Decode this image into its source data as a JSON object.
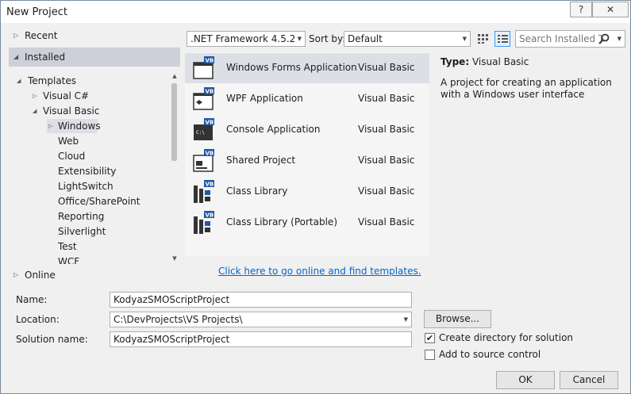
{
  "window": {
    "title": "New Project",
    "help_label": "?",
    "close_label": "✕"
  },
  "nav": {
    "recent": "Recent",
    "installed": "Installed",
    "online": "Online"
  },
  "tree": {
    "items": [
      {
        "label": "Templates"
      },
      {
        "label": "Visual C#"
      },
      {
        "label": "Visual Basic"
      },
      {
        "label": "Windows"
      },
      {
        "label": "Web"
      },
      {
        "label": "Cloud"
      },
      {
        "label": "Extensibility"
      },
      {
        "label": "LightSwitch"
      },
      {
        "label": "Office/SharePoint"
      },
      {
        "label": "Reporting"
      },
      {
        "label": "Silverlight"
      },
      {
        "label": "Test"
      },
      {
        "label": "WCF"
      }
    ]
  },
  "toolbar": {
    "framework": ".NET Framework 4.5.2",
    "sort_label": "Sort by:",
    "sort_value": "Default",
    "search_placeholder": "Search Installed Te"
  },
  "templates": [
    {
      "name": "Windows Forms Application",
      "lang": "Visual Basic",
      "icon": "winforms-icon"
    },
    {
      "name": "WPF Application",
      "lang": "Visual Basic",
      "icon": "wpf-icon"
    },
    {
      "name": "Console Application",
      "lang": "Visual Basic",
      "icon": "console-icon"
    },
    {
      "name": "Shared Project",
      "lang": "Visual Basic",
      "icon": "shared-project-icon"
    },
    {
      "name": "Class Library",
      "lang": "Visual Basic",
      "icon": "class-library-icon"
    },
    {
      "name": "Class Library (Portable)",
      "lang": "Visual Basic",
      "icon": "portable-library-icon"
    }
  ],
  "description": {
    "type_label": "Type:",
    "type_value": "Visual Basic",
    "text": "A project for creating an application with a Windows user interface"
  },
  "online_link": "Click here to go online and find templates.",
  "form": {
    "name_label": "Name:",
    "name_value": "KodyazSMOScriptProject",
    "location_label": "Location:",
    "location_value": "C:\\DevProjects\\VS Projects\\",
    "solution_label": "Solution name:",
    "solution_value": "KodyazSMOScriptProject",
    "browse_label": "Browse...",
    "create_dir_label": "Create directory for solution",
    "create_dir_checked": true,
    "source_control_label": "Add to source control",
    "source_control_checked": false,
    "ok_label": "OK",
    "cancel_label": "Cancel"
  },
  "colors": {
    "vb_blue": "#1e5aa8",
    "link": "#0066cc",
    "selection": "#cdd0d8"
  }
}
